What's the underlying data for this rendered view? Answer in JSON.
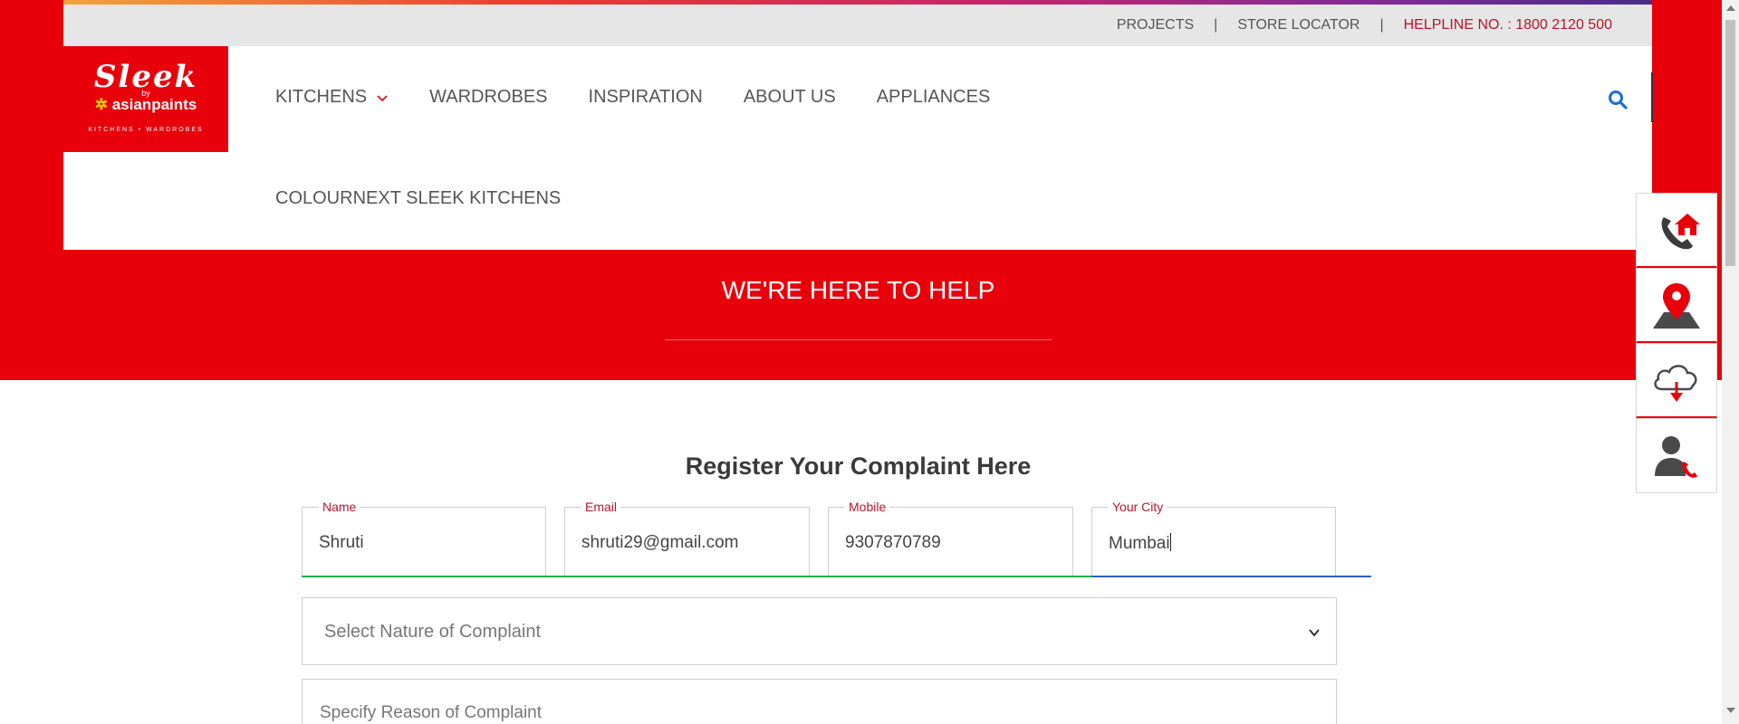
{
  "top_links": {
    "projects": "PROJECTS",
    "separator": "|",
    "store_locator": "STORE LOCATOR",
    "helpline": "HELPLINE NO. : 1800 2120 500"
  },
  "logo": {
    "brand": "Sleek",
    "by": "by",
    "parent": "asianpaints",
    "tagline": "KITCHENS • WARDROBES"
  },
  "nav": {
    "items": [
      "KITCHENS",
      "WARDROBES",
      "INSPIRATION",
      "ABOUT US",
      "APPLIANCES"
    ],
    "second_row": "COLOURNEXT SLEEK KITCHENS"
  },
  "hero": {
    "title": "WE'RE HERE TO HELP"
  },
  "form": {
    "title": "Register Your Complaint Here",
    "fields": [
      {
        "label": "Name",
        "value": "Shruti"
      },
      {
        "label": "Email",
        "value": "shruti29@gmail.com"
      },
      {
        "label": "Mobile",
        "value": "9307870789"
      },
      {
        "label": "Your City",
        "value": "Mumbai"
      }
    ],
    "nature_placeholder": "Select Nature of Complaint",
    "reason_placeholder": "Specify Reason  of Complaint"
  },
  "float_icons": [
    "home-call-icon",
    "location-pin-icon",
    "cloud-download-icon",
    "support-agent-icon"
  ],
  "colors": {
    "brand_red": "#e8000b",
    "label_red": "#b5162b",
    "valid_green": "#22b04b",
    "focus_blue": "#2a5fc4"
  }
}
